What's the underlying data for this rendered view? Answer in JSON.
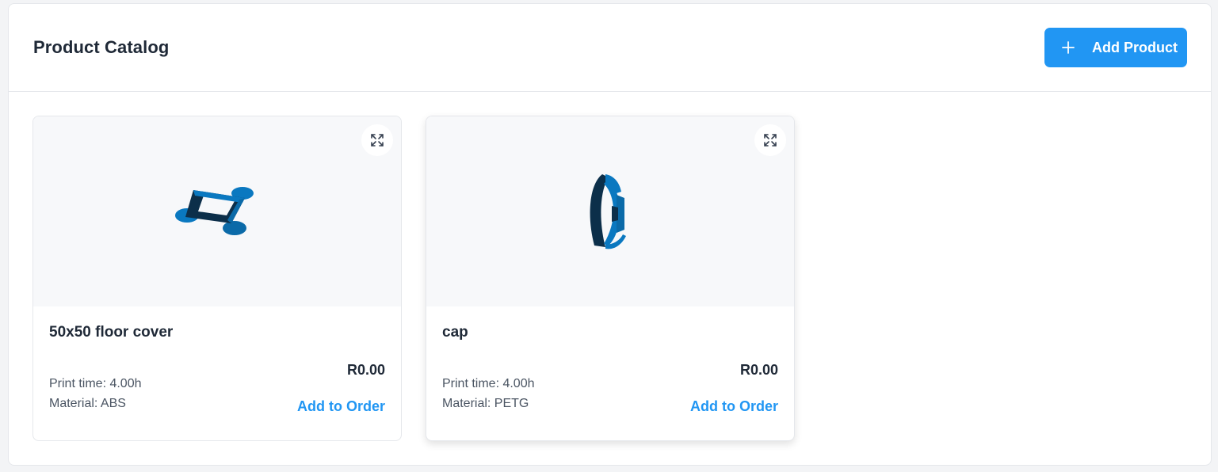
{
  "header": {
    "title": "Product Catalog",
    "add_button_label": "Add Product",
    "add_button_icon": "plus-icon"
  },
  "colors": {
    "accent": "#2196f3",
    "model_blue": "#0a78c0",
    "model_dark": "#0c2f4a",
    "image_bg": "#f7f8fa"
  },
  "products": [
    {
      "name": "50x50 floor cover",
      "price": "R0.00",
      "print_time": "Print time: 4.00h",
      "material": "Material: ABS",
      "action_label": "Add to Order",
      "expand_icon": "expand-icon",
      "model": "floor-cover-3d-model"
    },
    {
      "name": "cap",
      "price": "R0.00",
      "print_time": "Print time: 4.00h",
      "material": "Material: PETG",
      "action_label": "Add to Order",
      "expand_icon": "expand-icon",
      "model": "cap-3d-model"
    }
  ]
}
